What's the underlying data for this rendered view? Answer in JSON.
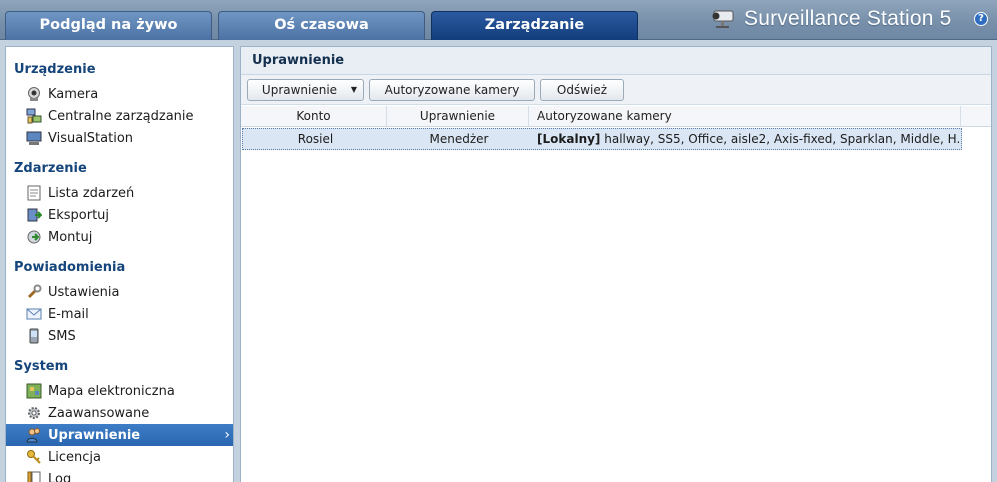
{
  "tabs": [
    {
      "label": "Podgląd na żywo"
    },
    {
      "label": "Oś czasowa"
    },
    {
      "label": "Zarządzanie"
    }
  ],
  "brand": {
    "title": "Surveillance Station 5",
    "help": "?"
  },
  "sidebar": {
    "sections": [
      {
        "title": "Urządzenie",
        "items": [
          {
            "label": "Kamera",
            "icon": "camera-icon"
          },
          {
            "label": "Centralne zarządzanie",
            "icon": "central-management-icon"
          },
          {
            "label": "VisualStation",
            "icon": "visualstation-icon"
          }
        ]
      },
      {
        "title": "Zdarzenie",
        "items": [
          {
            "label": "Lista zdarzeń",
            "icon": "event-list-icon"
          },
          {
            "label": "Eksportuj",
            "icon": "export-icon"
          },
          {
            "label": "Montuj",
            "icon": "mount-icon"
          }
        ]
      },
      {
        "title": "Powiadomienia",
        "items": [
          {
            "label": "Ustawienia",
            "icon": "wrench-icon"
          },
          {
            "label": "E-mail",
            "icon": "envelope-icon"
          },
          {
            "label": "SMS",
            "icon": "sms-icon"
          }
        ]
      },
      {
        "title": "System",
        "items": [
          {
            "label": "Mapa elektroniczna",
            "icon": "emap-icon"
          },
          {
            "label": "Zaawansowane",
            "icon": "gear-icon"
          },
          {
            "label": "Uprawnienie",
            "icon": "users-icon",
            "active": true
          },
          {
            "label": "Licencja",
            "icon": "key-icon"
          },
          {
            "label": "Log",
            "icon": "log-icon"
          }
        ]
      }
    ]
  },
  "main": {
    "title": "Uprawnienie",
    "toolbar": {
      "privilege_button": "Uprawnienie",
      "authorized_cameras_button": "Autoryzowane kamery",
      "refresh_button": "Odśwież"
    },
    "columns": [
      "Konto",
      "Uprawnienie",
      "Autoryzowane kamery"
    ],
    "rows": [
      {
        "account": "Rosiel",
        "privilege": "Menedżer",
        "cameras_prefix": "[Lokalny]",
        "cameras": "hallway, SS5, Office, aisle2, Axis-fixed, Sparklan, Middle, H..."
      }
    ]
  },
  "colors": {
    "accent": "#2a66b1",
    "section_title": "#15457a",
    "active_tab": "#123d7c"
  }
}
